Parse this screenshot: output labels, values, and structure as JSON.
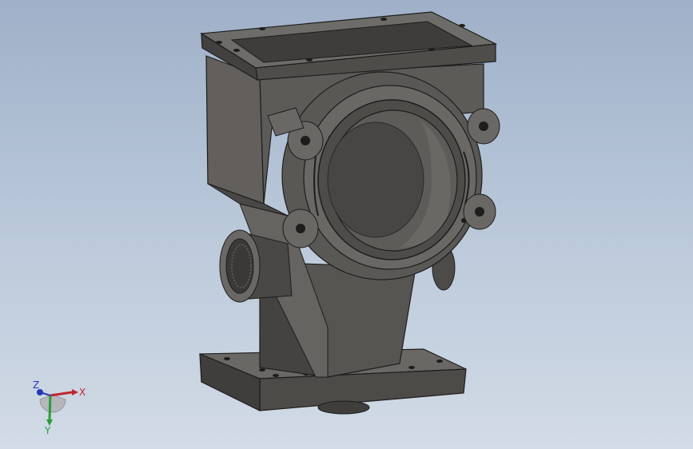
{
  "viewport": {
    "background_top": "#9fb0c8",
    "background_bottom": "#d2dbe6",
    "model_fill": "#5d5b58",
    "model_shadow": "#3a3937",
    "model_light": "#7d7b77",
    "edge_color": "#1e1d1c"
  },
  "triad": {
    "x_label": "X",
    "y_label": "Y",
    "z_label": "Z",
    "x_color": "#c0272d",
    "y_color": "#2a9b3a",
    "z_color": "#2438b5"
  }
}
